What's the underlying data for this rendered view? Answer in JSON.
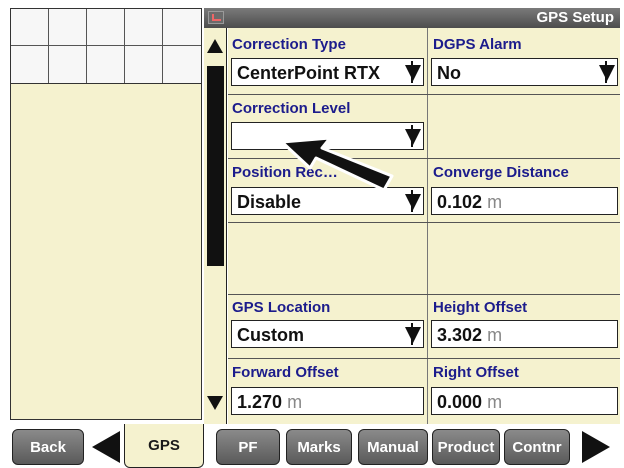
{
  "window": {
    "title": "GPS Setup"
  },
  "fields": {
    "correction_type": {
      "label": "Correction Type",
      "value": "CenterPoint RTX"
    },
    "dgps_alarm": {
      "label": "DGPS Alarm",
      "value": "No"
    },
    "correction_level": {
      "label": "Correction Level",
      "value": ""
    },
    "position_recall": {
      "label": "Position Rec…",
      "value": "Disable"
    },
    "converge_distance": {
      "label": "Converge Distance",
      "value": "0.102",
      "unit": "m"
    },
    "gps_location": {
      "label": "GPS Location",
      "value": "Custom"
    },
    "height_offset": {
      "label": "Height Offset",
      "value": "3.302",
      "unit": "m"
    },
    "forward_offset": {
      "label": "Forward Offset",
      "value": "1.270",
      "unit": "m"
    },
    "right_offset": {
      "label": "Right Offset",
      "value": "0.000",
      "unit": "m"
    }
  },
  "bottom_bar": {
    "back": "Back",
    "active_tab": "GPS",
    "pf": "PF",
    "marks": "Marks",
    "manual": "Manual",
    "product": "Product",
    "contnr": "Contnr"
  },
  "colors": {
    "panel_background": "#f5f2cf",
    "label_text": "#1c1c8c",
    "button_gray": "#6e6e6e"
  },
  "icons": [
    "window-icon",
    "scroll-up-arrow-icon",
    "scroll-down-arrow-icon",
    "dropdown-arrow-icon",
    "left-arrow-icon",
    "right-arrow-icon",
    "pointer-arrow-icon"
  ]
}
